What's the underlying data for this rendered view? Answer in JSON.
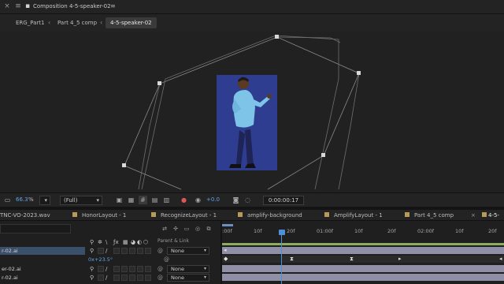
{
  "panel": {
    "title": "Composition 4-5-speaker-02",
    "menu_glyph": "≡"
  },
  "breadcrumbs": [
    {
      "label": "ERG_Part1"
    },
    {
      "label": "Part 4_5 comp"
    },
    {
      "label": "4-5-speaker-02"
    }
  ],
  "viewer_toolbar": {
    "zoom_value": "66.3",
    "zoom_unit": "%",
    "resolution": "(Full)",
    "exposure": "+0.0",
    "timecode": "0:00:00:17"
  },
  "tabs": [
    {
      "label": "TNC-VO-2023.wav"
    },
    {
      "label": "HonorLayout - 1"
    },
    {
      "label": "RecognizeLayout - 1"
    },
    {
      "label": "amplify-background"
    },
    {
      "label": "AmplifyLayout - 1"
    },
    {
      "label": "Part 4_5 comp"
    },
    {
      "label": "4-5-"
    }
  ],
  "timeline": {
    "ruler": [
      ":00f",
      "10f",
      "20f",
      "01:00f",
      "10f",
      "20f",
      "02:00f",
      "10f",
      "20f"
    ],
    "column_header": "Parent & Link",
    "layers": [
      {
        "name": "r-02.ai",
        "parent": "None"
      },
      {
        "name": "er-02.ai",
        "parent": "None"
      },
      {
        "name": "r-02.ai",
        "parent": "None"
      }
    ],
    "rotation_value": "0x+23.5°",
    "playhead_frame": 17
  },
  "colors": {
    "accent_blue": "#4d8fd8",
    "character_bg": "#2e3d8f",
    "layer_label": "#8f8fa6",
    "track_green": "#8cae5c"
  }
}
